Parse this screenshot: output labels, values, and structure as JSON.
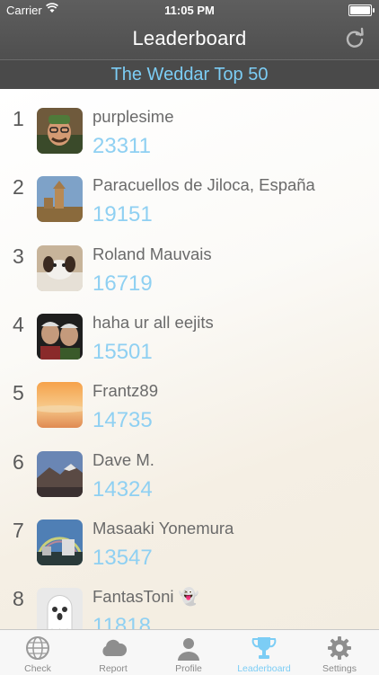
{
  "status_bar": {
    "carrier": "Carrier",
    "time": "11:05 PM"
  },
  "nav": {
    "title": "Leaderboard"
  },
  "banner": {
    "text": "The Weddar Top 50"
  },
  "leaderboard": [
    {
      "rank": "1",
      "name": "purplesime",
      "score": "23311"
    },
    {
      "rank": "2",
      "name": "Paracuellos  de Jiloca, España",
      "score": "19151"
    },
    {
      "rank": "3",
      "name": "Roland Mauvais",
      "score": "16719"
    },
    {
      "rank": "4",
      "name": "haha ur all eejits",
      "score": "15501"
    },
    {
      "rank": "5",
      "name": "Frantz89",
      "score": "14735"
    },
    {
      "rank": "6",
      "name": "Dave M.",
      "score": "14324"
    },
    {
      "rank": "7",
      "name": "Masaaki Yonemura",
      "score": "13547"
    },
    {
      "rank": "8",
      "name": "FantasToni 👻",
      "score": "11818"
    }
  ],
  "tabs": [
    {
      "label": "Check",
      "icon": "globe-icon"
    },
    {
      "label": "Report",
      "icon": "cloud-icon"
    },
    {
      "label": "Profile",
      "icon": "person-icon"
    },
    {
      "label": "Leaderboard",
      "icon": "trophy-icon"
    },
    {
      "label": "Settings",
      "icon": "gear-icon"
    }
  ],
  "colors": {
    "accent": "#7ccdf5",
    "nav_bg": "#555555",
    "score": "#8fd0f2",
    "text": "#6a6a6a"
  },
  "active_tab": "Leaderboard"
}
